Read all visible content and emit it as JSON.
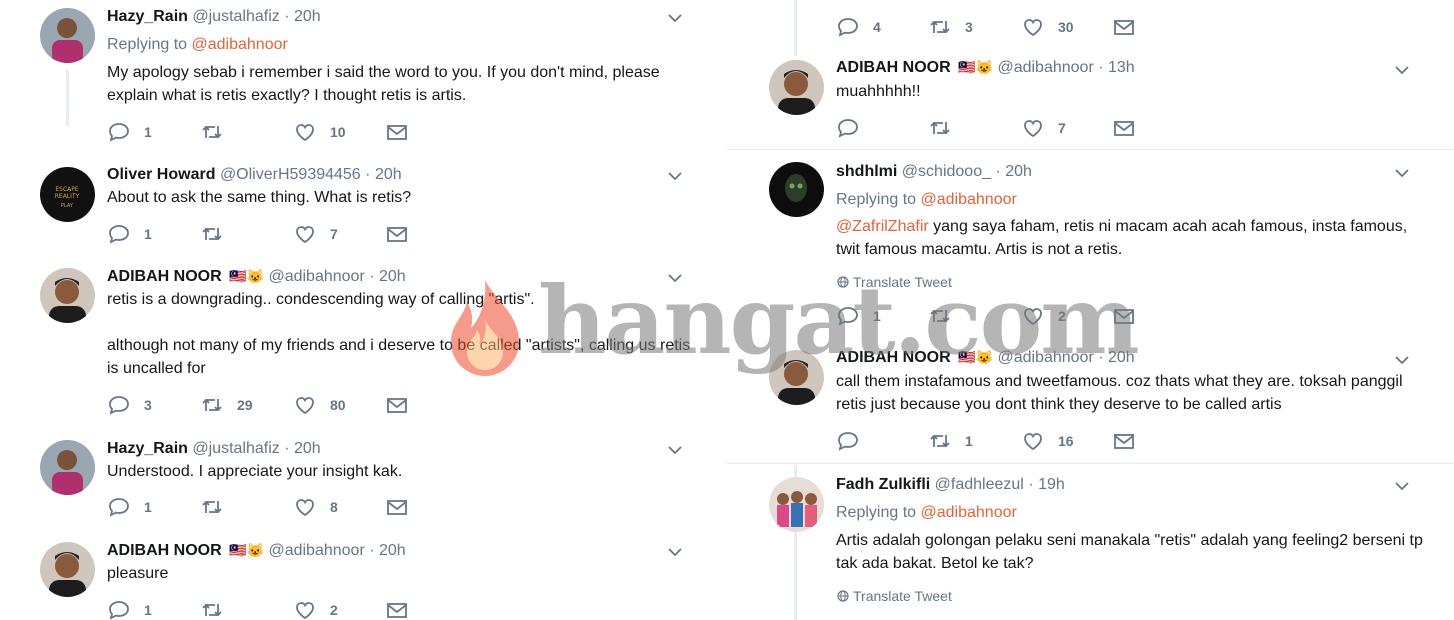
{
  "left": {
    "tweets": [
      {
        "name": "Hazy_Rain",
        "handle": "@justalhafiz",
        "time": "20h",
        "flag": "",
        "replying_label": "Replying to",
        "replying_to": "@adibahnoor",
        "lines": [
          "My apology sebab i remember i said the word to you. If you don't mind, please explain what is retis exactly? I thought retis is artis."
        ],
        "replies": "1",
        "retweets": "",
        "likes": "10"
      },
      {
        "name": "Oliver Howard",
        "handle": "@OliverH59394456",
        "time": "20h",
        "flag": "",
        "lines": [
          "About to ask the same thing. What is retis?"
        ],
        "replies": "1",
        "retweets": "",
        "likes": "7"
      },
      {
        "name": "ADIBAH NOOR",
        "handle": "@adibahnoor",
        "time": "20h",
        "flag": "🇲🇾😺",
        "lines": [
          "retis is a downgrading.. condescending way of calling \"artis\".",
          "although not many of my friends and i deserve to be called \"artists\", calling us retis is uncalled for"
        ],
        "replies": "3",
        "retweets": "29",
        "likes": "80"
      },
      {
        "name": "Hazy_Rain",
        "handle": "@justalhafiz",
        "time": "20h",
        "flag": "",
        "lines": [
          "Understood. I appreciate your insight kak."
        ],
        "replies": "1",
        "retweets": "",
        "likes": "8"
      },
      {
        "name": "ADIBAH NOOR",
        "handle": "@adibahnoor",
        "time": "20h",
        "flag": "🇲🇾😺",
        "lines": [
          "pleasure"
        ],
        "replies": "1",
        "retweets": "",
        "likes": "2"
      }
    ]
  },
  "right": {
    "top_actions": {
      "replies": "4",
      "retweets": "3",
      "likes": "30"
    },
    "tweets": [
      {
        "name": "ADIBAH NOOR",
        "handle": "@adibahnoor",
        "time": "13h",
        "flag": "🇲🇾😺",
        "lines": [
          "muahhhhh!!"
        ],
        "replies": "",
        "retweets": "",
        "likes": "7"
      },
      {
        "name": "shdhlmi",
        "handle": "@schidooo_",
        "time": "20h",
        "flag": "",
        "replying_label": "Replying to",
        "replying_to": "@adibahnoor",
        "mention": "@ZafrilZhafir",
        "lines": [
          "yang saya faham, retis ni macam acah acah famous, insta famous, twit famous macamtu. Artis is not a retis."
        ],
        "translate": "Translate Tweet",
        "replies": "1",
        "retweets": "",
        "likes": "2"
      },
      {
        "name": "ADIBAH NOOR",
        "handle": "@adibahnoor",
        "time": "20h",
        "flag": "🇲🇾😺",
        "lines": [
          "call them instafamous and tweetfamous. coz thats what they are. toksah panggil retis just because you dont think they deserve to be called artis"
        ],
        "replies": "",
        "retweets": "1",
        "likes": "16"
      },
      {
        "name": "Fadh Zulkifli",
        "handle": "@fadhleezul",
        "time": "19h",
        "flag": "",
        "replying_label": "Replying to",
        "replying_to": "@adibahnoor",
        "lines": [
          "Artis adalah golongan pelaku seni manakala \"retis\" adalah yang feeling2 berseni tp tak ada bakat. Betol ke tak?"
        ],
        "translate": "Translate Tweet"
      }
    ]
  },
  "watermark": {
    "text": "hangat.com"
  },
  "dot": "·"
}
